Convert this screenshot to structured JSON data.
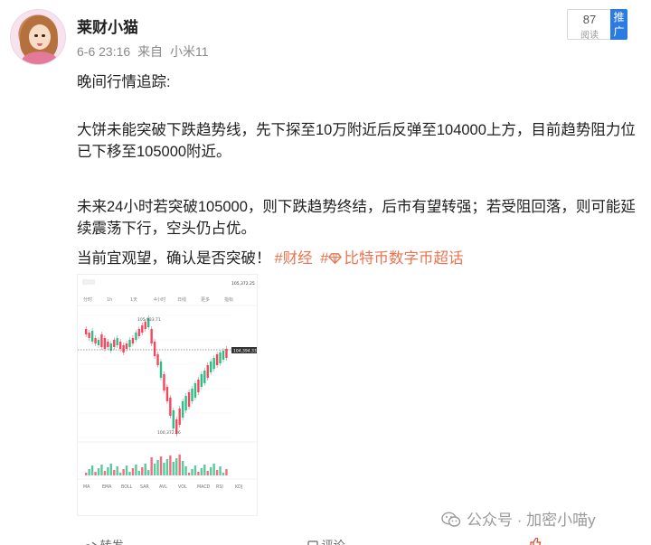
{
  "user": {
    "name": "莱财小猫",
    "date": "6-6 23:16",
    "source_prefix": "来自",
    "source_device": "小米11"
  },
  "read_badge": {
    "count": "87",
    "label": "阅读",
    "promote": "推广"
  },
  "post": {
    "line1": "晚间行情追踪:",
    "para1": "大饼未能突破下跌趋势线，先下探至10万附近后反弹至104000上方，目前趋势阻力位已下移至105000附近。",
    "para2": "未来24小时若突破105000，则下跌趋势终结，后市有望转强；若受阻回落，则可能延续震荡下行，空头仍占优。",
    "para3_text": "当前宜观望，确认是否突破！",
    "topic1": "#财经",
    "topic2": "#",
    "topic2_text": "比特币数字币超话"
  },
  "chart_image": {
    "top_price": "105,372.25",
    "high_label": "105,933.71",
    "low_label": "100,372.26",
    "current_price": "104,394.33",
    "tabs": [
      "分时",
      "1h",
      "1天",
      "4小时",
      "日线",
      "更多",
      "指标"
    ],
    "indicator_tabs": [
      "MA",
      "EMA",
      "BOLL",
      "SAR",
      "AVL",
      "VOL",
      "MACD",
      "RSI",
      "KDJ"
    ],
    "colors": {
      "up": "#2ebd85",
      "down": "#f6465d"
    }
  },
  "footer": {
    "account": "公众号 · 加密小喵y"
  },
  "bottom_bar": {
    "share": "转发",
    "comment": "评论"
  }
}
